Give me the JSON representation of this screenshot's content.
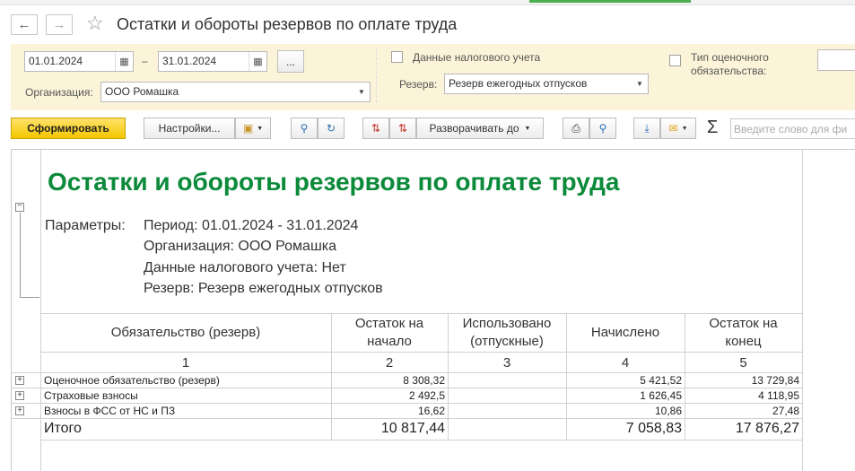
{
  "window": {
    "title": "Остатки и обороты резервов по оплате труда"
  },
  "filters": {
    "date_from": "01.01.2024",
    "date_dash": "–",
    "date_to": "31.01.2024",
    "period_btn": "...",
    "tax_label": "Данные налогового учета",
    "estimate_label_1": "Тип оценочного",
    "estimate_label_2": "обязательства:",
    "org_label": "Организация:",
    "org_value": "ООО Ромашка",
    "reserve_label": "Резерв:",
    "reserve_value": "Резерв ежегодных отпусков"
  },
  "toolbar": {
    "generate": "Сформировать",
    "settings": "Настройки...",
    "expand": "Разворачивать до",
    "search_placeholder": "Введите слово для фи"
  },
  "report": {
    "title": "Остатки и обороты резервов по оплате труда",
    "params_label": "Параметры:",
    "params": [
      "Период: 01.01.2024 - 31.01.2024",
      "Организация: ООО Ромашка",
      "Данные налогового учета: Нет",
      "Резерв: Резерв ежегодных отпусков"
    ],
    "headers": [
      [
        "Обязательство (резерв)"
      ],
      [
        "Остаток на",
        "начало"
      ],
      [
        "Использовано",
        "(отпускные)"
      ],
      [
        "Начислено"
      ],
      [
        "Остаток на",
        "конец"
      ]
    ],
    "col_numbers": [
      "1",
      "2",
      "3",
      "4",
      "5"
    ],
    "rows": [
      [
        "Оценочное обязательство (резерв)",
        "8 308,32",
        "",
        "5 421,52",
        "13 729,84"
      ],
      [
        "Страховые взносы",
        "2 492,5",
        "",
        "1 626,45",
        "4 118,95"
      ],
      [
        "Взносы в ФСС от НС и ПЗ",
        "16,62",
        "",
        "10,86",
        "27,48"
      ]
    ],
    "total": [
      "Итого",
      "10 817,44",
      "",
      "7 058,83",
      "17 876,27"
    ]
  }
}
